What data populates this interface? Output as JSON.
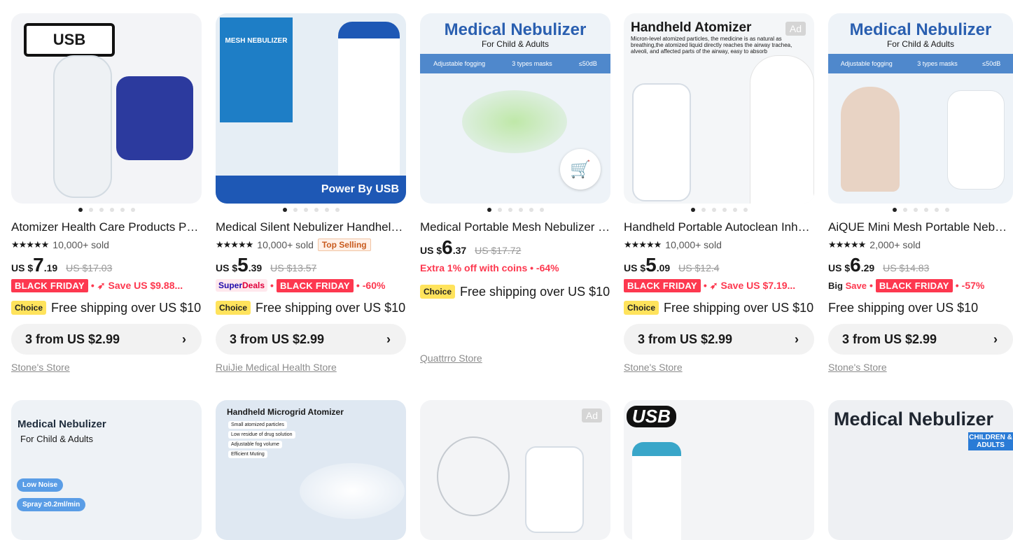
{
  "row1": [
    {
      "title": "Atomizer Health Care Products Portable...",
      "stars": "★★★★★",
      "sold": "10,000+ sold",
      "cur": "US $",
      "int": "7",
      "dec": ".19",
      "old": "US $17.03",
      "promo": {
        "type": "bf_save",
        "bf": "BLACK FRIDAY",
        "save": "Save US $9.88..."
      },
      "choice": "Choice",
      "ship": "Free shipping over US $10",
      "bundle": "3 from US $2.99",
      "store": "Stone's Store",
      "art": {
        "tag": "USB"
      }
    },
    {
      "title": "Medical Silent Nebulizer Handheld Portable",
      "stars": "★★★★★",
      "sold": "10,000+ sold",
      "topsell": "Top Selling",
      "cur": "US $",
      "int": "5",
      "dec": ".39",
      "old": "US $13.57",
      "promo": {
        "type": "sd_bf",
        "sd1": "Super",
        "sd2": "Deals",
        "bf": "BLACK FRIDAY",
        "pct": "-60%"
      },
      "choice": "Choice",
      "ship": "Free shipping over US $10",
      "bundle": "3 from US $2.99",
      "store": "RuiJie Medical Health Store",
      "art": {
        "tag": "Power By USB",
        "box": "MESH NEBULIZER"
      }
    },
    {
      "title": "Medical Portable Mesh Nebulizer Handheld",
      "cur": "US $",
      "int": "6",
      "dec": ".37",
      "old": "US $17.72",
      "coins": "Extra 1% off with coins • -64%",
      "choice": "Choice",
      "ship": "Free shipping over US $10",
      "store": "Quattrro Store",
      "art": {
        "h1": "Medical Nebulizer",
        "h2": "For Child & Adults",
        "f1": "Adjustable fogging",
        "f2": "3 types masks",
        "f3": "≤50dB"
      }
    },
    {
      "title": "Handheld Portable Autoclean Inhaler Nebulizer",
      "stars": "★★★★★",
      "sold": "10,000+ sold",
      "cur": "US $",
      "int": "5",
      "dec": ".09",
      "old": "US $12.4",
      "promo": {
        "type": "bf_save",
        "bf": "BLACK FRIDAY",
        "save": "Save US $7.19..."
      },
      "choice": "Choice",
      "ship": "Free shipping over US $10",
      "bundle": "3 from US $2.99",
      "store": "Stone's Store",
      "ad": "Ad",
      "art": {
        "h1": "Handheld Atomizer",
        "p": "Micron-level atomized particles, the medicine is as natural as breathing,the atomized liquid directly reaches the airway trachea, alveoli, and affected parts of the airway, easy to absorb"
      }
    },
    {
      "title": "AiQUE Mini Mesh Portable Nebulizer",
      "stars": "★★★★★",
      "sold": "2,000+ sold",
      "cur": "US $",
      "int": "6",
      "dec": ".29",
      "old": "US $14.83",
      "promo": {
        "type": "big_bf",
        "big": "Big",
        "save": "Save",
        "bf": "BLACK FRIDAY",
        "pct": "-57%"
      },
      "ship": "Free shipping over US $10",
      "bundle": "3 from US $2.99",
      "store": "Stone's Store",
      "art": {
        "h1": "Medical Nebulizer",
        "h2": "For Child & Adults",
        "f1": "Adjustable fogging",
        "f2": "3 types masks",
        "f3": "≤50dB"
      }
    }
  ],
  "row2": [
    {
      "art": {
        "h1": "Medical Nebulizer",
        "h2": "For Child & Adults",
        "b1": "Low Noise",
        "b2": "Spray ≥0.2ml/min"
      }
    },
    {
      "art": {
        "h1": "Handheld Microgrid Atomizer",
        "l1": "Small atomized particles",
        "l2": "Low residue of drug solution",
        "l3": "Adjustable fog volume",
        "l4": "Efficient Muting"
      }
    },
    {
      "ad": "Ad"
    },
    {
      "art": {
        "tag": "USB"
      }
    },
    {
      "art": {
        "h1": "Medical Nebulizer",
        "h2": "CHILDREN & ADULTS"
      }
    }
  ]
}
